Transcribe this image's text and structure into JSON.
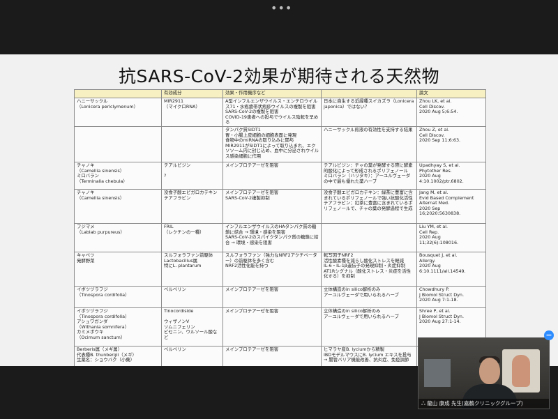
{
  "toolbar": {
    "more_label": "•••"
  },
  "slide": {
    "title": "抗SARS-CoV-2効果が期待される天然物",
    "table": {
      "headers": [
        "",
        "有効成分",
        "効果・作用機序など",
        "",
        "論文"
      ],
      "rows": [
        [
          "ハニーサックル\n（Lonicera periclymenum）",
          "MIR2911\n（マイクロRNA）",
          "A型インフルエンザウイルス・エンテロウイルス71・水疱瘡帯状疱疹ウイルスの複製を阻害\nSARS-CoV-2の複製を阻害\nCOVID-19患者への投与でウイルス陰転を早める",
          "日本に自生する近縁種スイカズラ（Lonicera japonica）ではない？",
          "Zhou LK, et al.\nCell Discov.\n2020 Aug 5;6:54."
        ],
        [
          "",
          "",
          "タンパク質SIDT1\n胃・小腸上皮細胞の細胞表面に発現\n食物中のmiRNAの取り込みに関与\nMIR2911がSIDT1によって取り込まれ、エクソソーム内に封じ込め、血中に分泌されウイルス感染細胞に作用",
          "ハニーサックル煎液の有効性を支持する結果",
          "Zhou Z, et al.\nCell Discov.\n2020 Sep 11;6:63."
        ],
        [
          "チャノキ\n（Camellia sinensis）\nミロバラン\n（Terminalia chebula）",
          "テアルビジン\n\n?",
          "メインプロテアーゼを阻害",
          "テアルビジン：チャの葉が発酵する際に酵素的酸化によって形成されるポリフェノール\nミロバラン（ハリタキ）：アーユルヴェーダの中で最も優れた薬ハーブ",
          "Upadhyay S, et al.\nPhytother Res.\n2020 Aug\n4:10.1002/ptr.6802."
        ],
        [
          "チャノキ\n（Camellia sinensis）",
          "没食子酸エピガロカテキン\nテアフラビン",
          "メインプロテアーゼを阻害\nSARS-CoV-2複製抑制",
          "没食子酸エピガロカテキン：緑茶に豊富に含まれているポリフェノールで強い抗酸化活性\nテアフラビン：紅茶に豊富に含まれているポリフェノールで、チャの葉の発酵過程で生成",
          "Jang M, et al.\nEvid Based Complement Alternat Med.\n2020 Sep\n16;2020:5630838."
        ],
        [
          "フジマメ\n（Lablab purpureus）",
          "FRIL\n（レクチンの一種）",
          "インフルエンザウイルスのHAタンパク質の糖鎖に結合 → 環境・感染を阻害\nSARS-CoV-2のスパイクタンパク質の糖鎖に結合 → 環境・感染を阻害",
          "",
          "Liu YM, et al.\nCell Rep.\n2020 Aug\n11;32(6):108016."
        ],
        [
          "キャベツ\n発酵野菜",
          "スルフォラファン前駆体\nLactobacillus属\n特にL. plantarum",
          "スルフォラファン（強力なNRF2アクチベーター）の前駆体を多く含む\nNRF2活性化能を持つ",
          "転写因子NRF2\n活性酸素種を減らし酸化ストレスを軽減\nIL-6・IL-1β遺伝子の発現抑制・炎症抑制\nAT1Rシグナル（酸化ストレス・炎症を活性化する）を抑制",
          "Bousquet J, et al.\nAllergy.\n2020 Aug\n6:10.1111/all.14549."
        ],
        [
          "イボツヅラフジ\n（Tinospora cordifolia）",
          "ベルベリン",
          "メインプロテアーゼを阻害",
          "立体構造のin silico解析のみ\nアーユルヴェーダで用いられるハーブ",
          "Chowdhury P.\nJ Biomol Struct Dyn.\n2020 Aug 7:1-18."
        ],
        [
          "イボツヅラフジ\n（Tinospora cordifolia）\nアシュワガンダ\n（Withania somnifera）\nカミメボウキ\n（Ocimum sanctum）",
          "Tinocordiside\n\nウィザノンV\nソムニフェリン\nビセニン、ウルソール酸など",
          "メインプロテアーゼを阻害",
          "立体構造のin silico解析のみ\nアーユルヴェーダで用いられるハーブ",
          "Shree P, et al.\nJ Biomol Struct Dyn.\n2020 Aug 27:1-14."
        ],
        [
          "Berberis属（メギ属）\n代表種B. thunbergii（メギ）\n生薬名：ショウバク（小蘗）",
          "ベルベリン",
          "メインプロテアーゼを阻害",
          "ヒマラヤ産B. lyciumから精製\nIBDモデルマウスにB. lycium エキスを投与\n→ 腸管バリア機能改善、抗炎症、免疫調節",
          ""
        ]
      ]
    }
  },
  "video": {
    "participant_name": "ஃ 龍山 康成 先生(嘉鶴クリニックグループ)"
  },
  "controls": {
    "minus_label": "−"
  }
}
